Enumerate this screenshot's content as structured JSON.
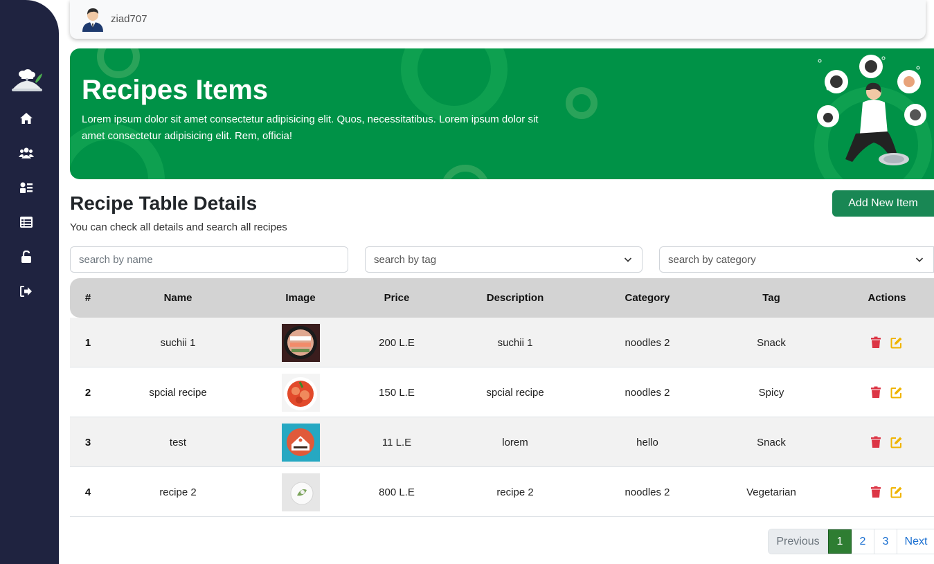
{
  "topbar": {
    "username": "ziad707"
  },
  "sidebar": {
    "items": [
      {
        "name": "home",
        "icon": "home-icon"
      },
      {
        "name": "users",
        "icon": "users-icon"
      },
      {
        "name": "recipes",
        "icon": "recipe-list-icon"
      },
      {
        "name": "categories",
        "icon": "table-icon"
      },
      {
        "name": "change-password",
        "icon": "unlock-icon"
      },
      {
        "name": "logout",
        "icon": "logout-icon"
      }
    ]
  },
  "hero": {
    "title": "Recipes Items",
    "description": "Lorem ipsum dolor sit amet consectetur adipisicing elit. Quos, necessitatibus. Lorem ipsum dolor sit amet consectetur adipisicing elit. Rem, officia!"
  },
  "section": {
    "title": "Recipe Table Details",
    "subtitle": "You can check all details and search all recipes",
    "add_button": "Add New Item"
  },
  "filters": {
    "name_placeholder": "search by name",
    "tag_selected": "search by tag",
    "category_selected": "search by category"
  },
  "table": {
    "headers": [
      "#",
      "Name",
      "Image",
      "Price",
      "Description",
      "Category",
      "Tag",
      "Actions"
    ],
    "rows": [
      {
        "num": "1",
        "name": "suchii 1",
        "price": "200 L.E",
        "description": "suchii 1",
        "category": "noodles 2",
        "tag": "Snack"
      },
      {
        "num": "2",
        "name": "spcial recipe",
        "price": "150 L.E",
        "description": "spcial recipe",
        "category": "noodles 2",
        "tag": "Spicy"
      },
      {
        "num": "3",
        "name": "test",
        "price": "11 L.E",
        "description": "lorem",
        "category": "hello",
        "tag": "Snack"
      },
      {
        "num": "4",
        "name": "recipe 2",
        "price": "800 L.E",
        "description": "recipe 2",
        "category": "noodles 2",
        "tag": "Vegetarian"
      }
    ]
  },
  "pagination": {
    "previous": "Previous",
    "pages": [
      "1",
      "2",
      "3"
    ],
    "active": "1",
    "next": "Next"
  },
  "colors": {
    "sidebar": "#1f2340",
    "hero": "#009247",
    "primary_button": "#198754",
    "delete": "#dc3545",
    "edit": "#f0b400"
  }
}
